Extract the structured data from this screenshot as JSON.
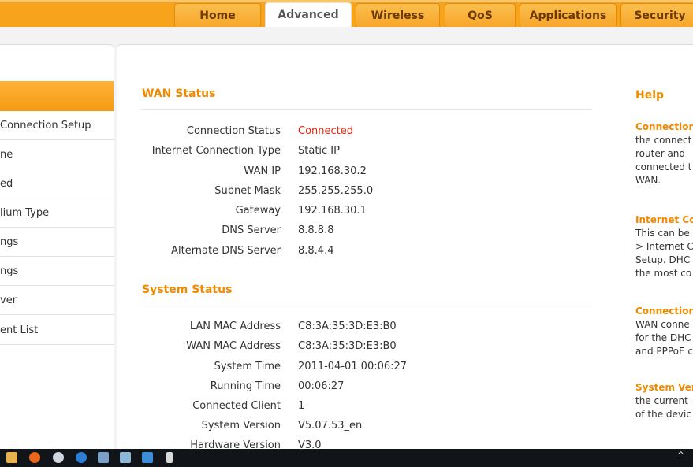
{
  "nav": {
    "tabs": [
      {
        "label": "Home"
      },
      {
        "label": "Advanced"
      },
      {
        "label": "Wireless"
      },
      {
        "label": "QoS"
      },
      {
        "label": "Applications"
      },
      {
        "label": "Security"
      }
    ],
    "active_tab": "Advanced"
  },
  "sidebar": {
    "items": [
      {
        "label": "Connection Setup"
      },
      {
        "label": "ne"
      },
      {
        "label": "ed"
      },
      {
        "label": "lium Type"
      },
      {
        "label": "ngs"
      },
      {
        "label": "ngs"
      },
      {
        "label": "ver"
      },
      {
        "label": "ent List"
      }
    ]
  },
  "wan_status": {
    "title": "WAN Status",
    "rows": [
      {
        "label": "Connection Status",
        "value": "Connected"
      },
      {
        "label": "Internet Connection Type",
        "value": "Static IP"
      },
      {
        "label": "WAN IP",
        "value": "192.168.30.2"
      },
      {
        "label": "Subnet Mask",
        "value": "255.255.255.0"
      },
      {
        "label": "Gateway",
        "value": "192.168.30.1"
      },
      {
        "label": "DNS Server",
        "value": "8.8.8.8"
      },
      {
        "label": "Alternate DNS Server",
        "value": "8.8.4.4"
      }
    ]
  },
  "system_status": {
    "title": "System Status",
    "rows": [
      {
        "label": "LAN MAC Address",
        "value": "C8:3A:35:3D:E3:B0"
      },
      {
        "label": "WAN MAC Address",
        "value": "C8:3A:35:3D:E3:B0"
      },
      {
        "label": "System Time",
        "value": "2011-04-01 00:06:27"
      },
      {
        "label": "Running Time",
        "value": "00:06:27"
      },
      {
        "label": "Connected Client",
        "value": "1"
      },
      {
        "label": "System Version",
        "value": "V5.07.53_en"
      },
      {
        "label": "Hardware Version",
        "value": "V3.0"
      }
    ]
  },
  "help": {
    "title": "Help",
    "sections": [
      {
        "heading": "Connection",
        "text": "the connect\nrouter and\nconnected t\nWAN."
      },
      {
        "heading": "Internet Co",
        "text": "This can be\n> Internet C\nSetup. DHC\nthe most co"
      },
      {
        "heading": "Connection",
        "text": "WAN conne\nfor the DHC\nand PPPoE c"
      },
      {
        "heading": "System Ver",
        "text": "the current\nof the devic"
      }
    ]
  },
  "colors": {
    "accent": "#f7a31c",
    "title": "#f08a00",
    "connected": "#e8250c"
  }
}
